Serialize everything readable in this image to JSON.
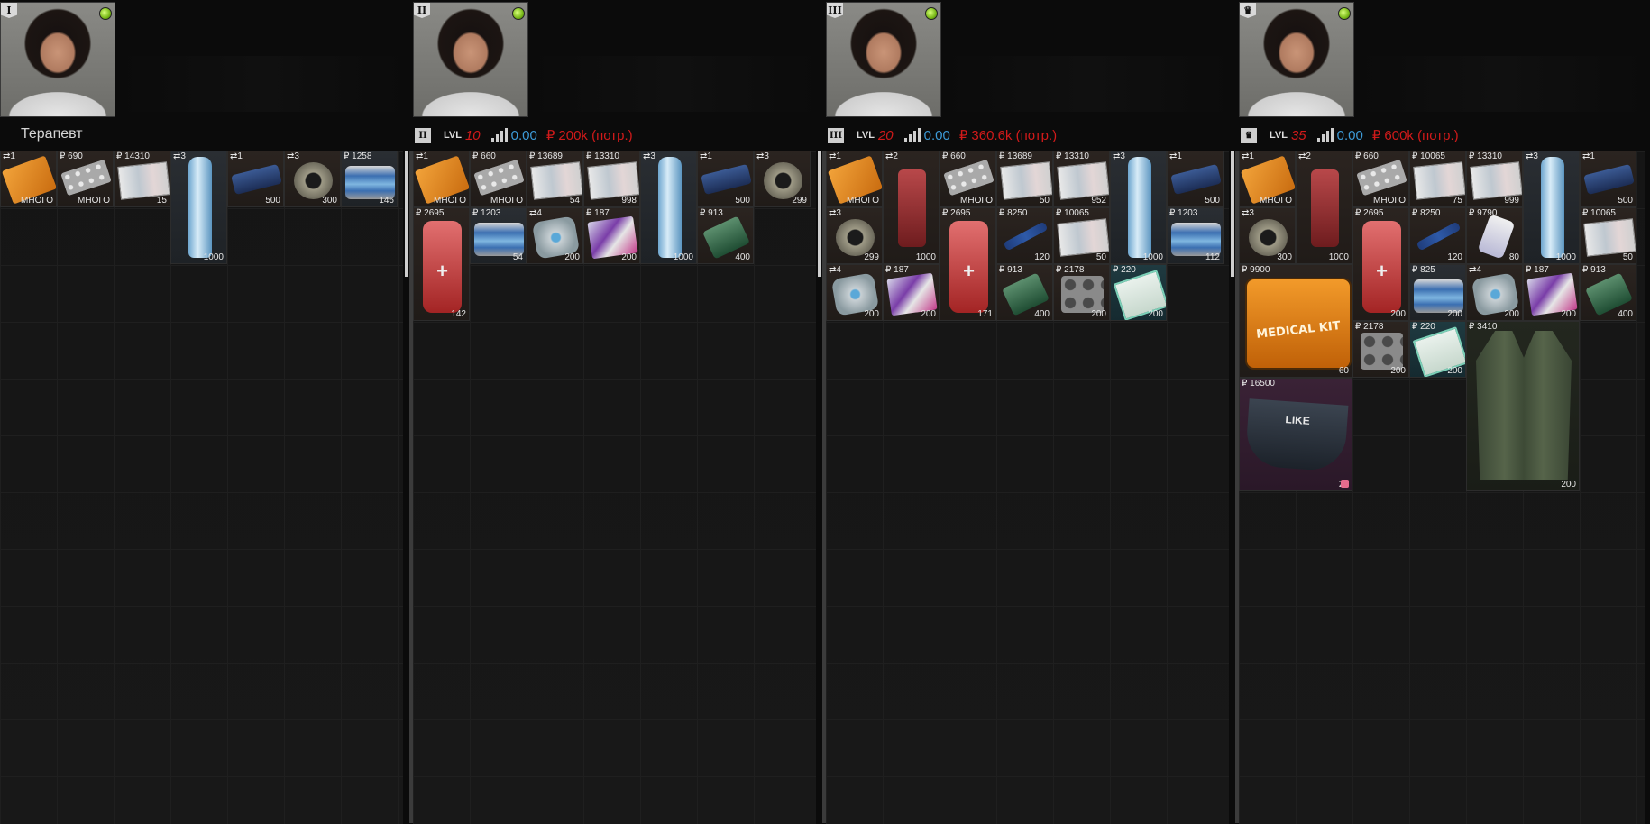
{
  "panels": [
    {
      "rank": "I",
      "name": "Терапевт",
      "level": "",
      "rep": "",
      "spend": "",
      "items": [
        {
          "price": "⇄1",
          "qty": "МНОГО",
          "icon": "orange-pack-icon"
        },
        {
          "price": "₽ 690",
          "qty": "МНОГО",
          "icon": "pills-icon"
        },
        {
          "price": "₽ 14310",
          "qty": "15",
          "icon": "map-icon"
        },
        {
          "price": "⇄3",
          "qty": "1000",
          "icon": "water-bottle-icon"
        },
        {
          "price": "⇄1",
          "qty": "500",
          "icon": "blue-stick-icon"
        },
        {
          "price": "⇄3",
          "qty": "300",
          "icon": "roll-icon"
        },
        {
          "price": "₽ 1258",
          "qty": "146",
          "icon": "can-icon"
        }
      ]
    },
    {
      "rank": "II",
      "name": "",
      "level": "10",
      "rep": "0.00",
      "spend": "200k (потр.)",
      "items": [
        {
          "price": "⇄1",
          "qty": "МНОГО",
          "icon": "orange-pack-icon"
        },
        {
          "price": "₽ 660",
          "qty": "МНОГО",
          "icon": "pills-icon"
        },
        {
          "price": "₽ 13689",
          "qty": "54",
          "icon": "map-icon"
        },
        {
          "price": "₽ 13310",
          "qty": "998",
          "icon": "map-icon"
        },
        {
          "price": "⇄3",
          "qty": "1000",
          "icon": "water-bottle-icon"
        },
        {
          "price": "⇄1",
          "qty": "500",
          "icon": "blue-stick-icon"
        },
        {
          "price": "⇄3",
          "qty": "299",
          "icon": "roll-icon"
        },
        {
          "price": "₽ 2695",
          "qty": "142",
          "icon": "firstaid-icon"
        },
        {
          "price": "₽ 1203",
          "qty": "54",
          "icon": "can-icon"
        },
        {
          "price": "⇄4",
          "qty": "200",
          "icon": "bandage-icon"
        },
        {
          "price": "₽ 187",
          "qty": "200",
          "icon": "snack-icon"
        },
        {
          "price": "₽ 913",
          "qty": "400",
          "icon": "green-tube-icon"
        }
      ]
    },
    {
      "rank": "III",
      "name": "",
      "level": "20",
      "rep": "0.00",
      "spend": "360.6k (потр.)",
      "items": [
        {
          "price": "⇄1",
          "qty": "МНОГО",
          "icon": "orange-pack-icon"
        },
        {
          "price": "⇄2",
          "qty": "1000",
          "icon": "red-kit-icon"
        },
        {
          "price": "₽ 660",
          "qty": "МНОГО",
          "icon": "pills-icon"
        },
        {
          "price": "₽ 13689",
          "qty": "50",
          "icon": "map-icon"
        },
        {
          "price": "₽ 13310",
          "qty": "952",
          "icon": "map-icon"
        },
        {
          "price": "⇄3",
          "qty": "1000",
          "icon": "water-bottle-icon"
        },
        {
          "price": "⇄1",
          "qty": "500",
          "icon": "blue-stick-icon"
        },
        {
          "price": "⇄3",
          "qty": "299",
          "icon": "roll-icon"
        },
        {
          "price": "₽ 2695",
          "qty": "171",
          "icon": "firstaid-icon"
        },
        {
          "price": "₽ 8250",
          "qty": "120",
          "icon": "injector-icon"
        },
        {
          "price": "₽ 10065",
          "qty": "50",
          "icon": "map-icon"
        },
        {
          "price": "₽ 1203",
          "qty": "112",
          "icon": "can-icon"
        },
        {
          "price": "⇄4",
          "qty": "200",
          "icon": "bandage-icon"
        },
        {
          "price": "₽ 187",
          "qty": "200",
          "icon": "snack-icon"
        },
        {
          "price": "₽ 913",
          "qty": "400",
          "icon": "green-tube-icon"
        },
        {
          "price": "₽ 2178",
          "qty": "200",
          "icon": "blister-icon"
        },
        {
          "price": "₽ 220",
          "qty": "200",
          "icon": "gum-icon"
        }
      ]
    },
    {
      "rank": "crown",
      "name": "",
      "level": "35",
      "rep": "0.00",
      "spend": "600k (потр.)",
      "items": [
        {
          "price": "⇄1",
          "qty": "МНОГО",
          "icon": "orange-pack-icon"
        },
        {
          "price": "⇄2",
          "qty": "1000",
          "icon": "red-kit-icon"
        },
        {
          "price": "₽ 660",
          "qty": "МНОГО",
          "icon": "pills-icon"
        },
        {
          "price": "₽ 10065",
          "qty": "75",
          "icon": "map-icon"
        },
        {
          "price": "₽ 13310",
          "qty": "999",
          "icon": "map-icon"
        },
        {
          "price": "⇄3",
          "qty": "1000",
          "icon": "water-bottle-icon"
        },
        {
          "price": "⇄1",
          "qty": "500",
          "icon": "blue-stick-icon"
        },
        {
          "price": "⇄3",
          "qty": "300",
          "icon": "roll-icon"
        },
        {
          "price": "₽ 2695",
          "qty": "200",
          "icon": "firstaid-icon"
        },
        {
          "price": "₽ 8250",
          "qty": "120",
          "icon": "injector-icon"
        },
        {
          "price": "₽ 9790",
          "qty": "80",
          "icon": "spray-bottle-icon"
        },
        {
          "price": "₽ 10065",
          "qty": "50",
          "icon": "map-icon"
        },
        {
          "price": "₽ 9900",
          "qty": "60",
          "icon": "medical-kit-bag-icon",
          "label": "MEDICAL KIT"
        },
        {
          "price": "₽ 825",
          "qty": "200",
          "icon": "can-icon"
        },
        {
          "price": "⇄4",
          "qty": "200",
          "icon": "bandage-icon"
        },
        {
          "price": "₽ 187",
          "qty": "200",
          "icon": "snack-icon"
        },
        {
          "price": "₽ 913",
          "qty": "400",
          "icon": "green-tube-icon"
        },
        {
          "price": "₽ 2178",
          "qty": "200",
          "icon": "blister-icon"
        },
        {
          "price": "₽ 220",
          "qty": "200",
          "icon": "gum-icon"
        },
        {
          "price": "₽ 3410",
          "qty": "200",
          "icon": "vest-icon"
        },
        {
          "price": "₽ 16500",
          "qty": "20",
          "icon": "waist-pouch-icon",
          "label": "LIKE"
        }
      ]
    }
  ]
}
